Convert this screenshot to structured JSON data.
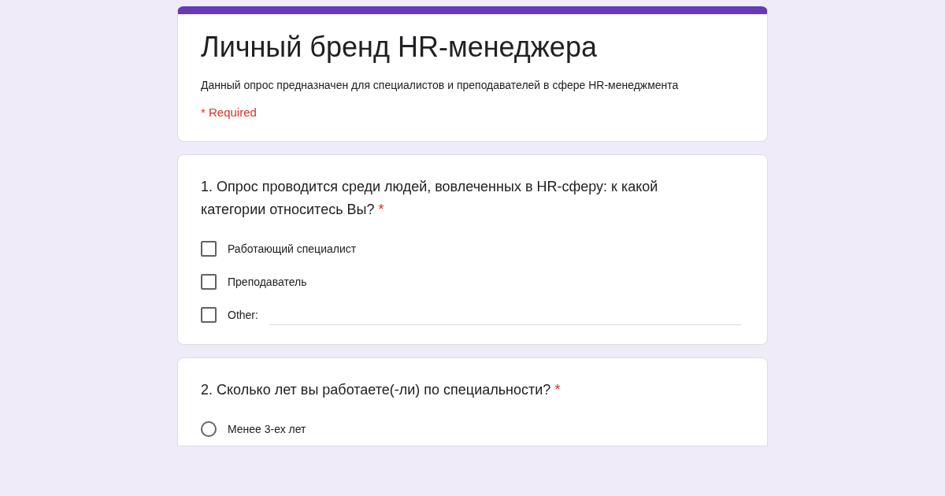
{
  "header": {
    "title": "Личный бренд HR-менеджера",
    "description": "Данный опрос предназначен для специалистов и преподавателей в сфере HR-менеджмента",
    "required_note": "* Required"
  },
  "questions": [
    {
      "text": "1. Опрос проводится среди людей, вовлеченных в HR-сферу: к какой категории относитесь Вы?",
      "required_mark": "*",
      "options": [
        {
          "kind": "checkbox",
          "label": "Работающий специалист",
          "checked": false
        },
        {
          "kind": "checkbox",
          "label": "Преподаватель",
          "checked": false
        },
        {
          "kind": "other",
          "label": "Other:",
          "checked": false
        }
      ]
    },
    {
      "text": "2. Сколько лет вы работаете(-ли) по специальности?",
      "required_mark": "*",
      "options": [
        {
          "kind": "radio",
          "label": "Менее 3-ех лет",
          "checked": false
        }
      ]
    }
  ]
}
